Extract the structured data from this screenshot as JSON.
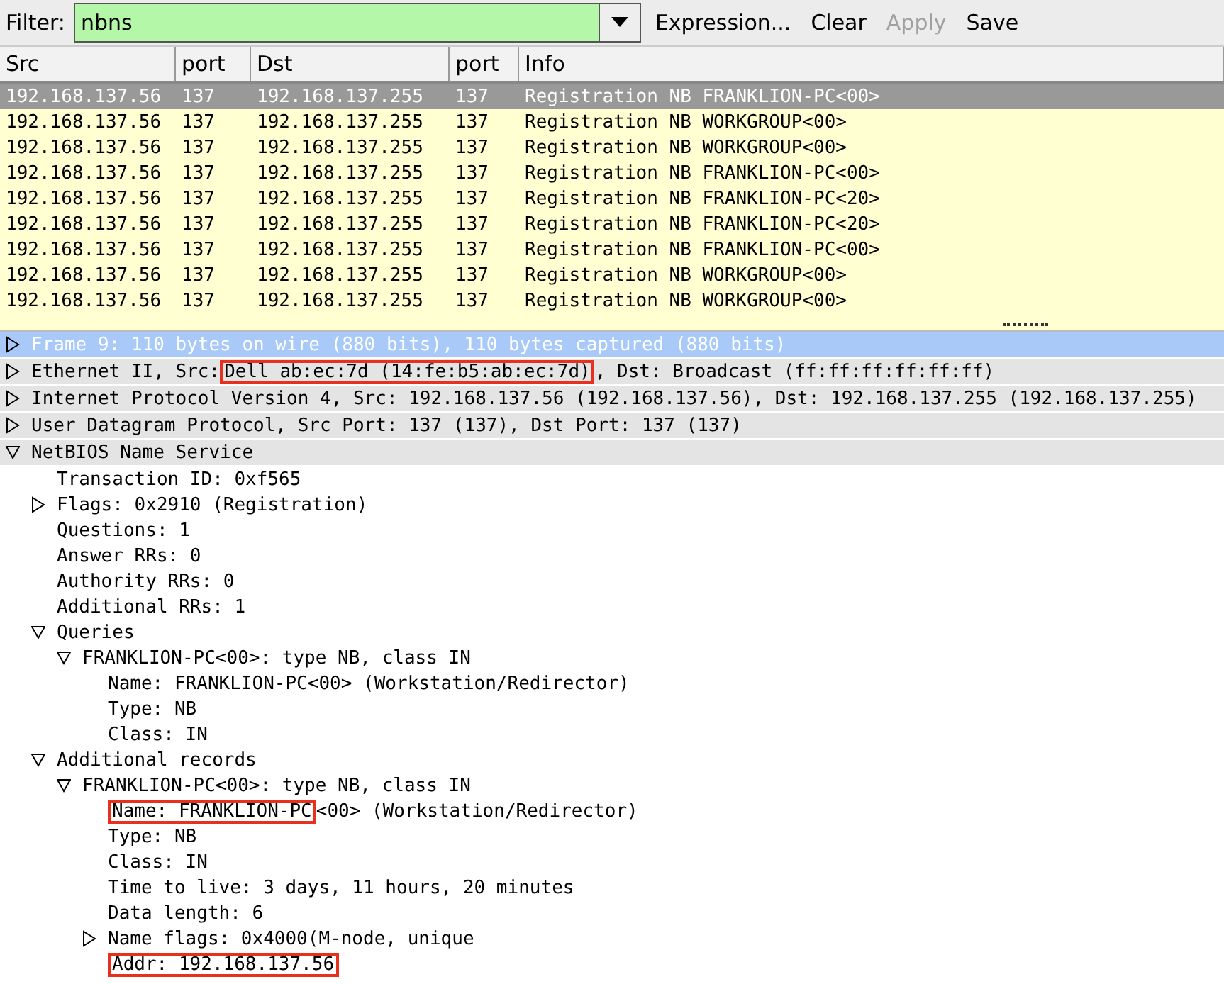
{
  "filter": {
    "label": "Filter:",
    "value": "nbns",
    "buttons": [
      {
        "label": "Expression...",
        "disabled": false
      },
      {
        "label": "Clear",
        "disabled": false
      },
      {
        "label": "Apply",
        "disabled": true
      },
      {
        "label": "Save",
        "disabled": false
      }
    ]
  },
  "packets": {
    "columns": [
      "Src",
      "port",
      "Dst",
      "port",
      "Info"
    ],
    "rows": [
      {
        "cells": [
          "192.168.137.56",
          "137",
          "192.168.137.255",
          "137",
          "Registration NB FRANKLION-PC<00>"
        ],
        "selected": true
      },
      {
        "cells": [
          "192.168.137.56",
          "137",
          "192.168.137.255",
          "137",
          "Registration NB WORKGROUP<00>"
        ],
        "selected": false
      },
      {
        "cells": [
          "192.168.137.56",
          "137",
          "192.168.137.255",
          "137",
          "Registration NB WORKGROUP<00>"
        ],
        "selected": false
      },
      {
        "cells": [
          "192.168.137.56",
          "137",
          "192.168.137.255",
          "137",
          "Registration NB FRANKLION-PC<00>"
        ],
        "selected": false
      },
      {
        "cells": [
          "192.168.137.56",
          "137",
          "192.168.137.255",
          "137",
          "Registration NB FRANKLION-PC<20>"
        ],
        "selected": false
      },
      {
        "cells": [
          "192.168.137.56",
          "137",
          "192.168.137.255",
          "137",
          "Registration NB FRANKLION-PC<20>"
        ],
        "selected": false
      },
      {
        "cells": [
          "192.168.137.56",
          "137",
          "192.168.137.255",
          "137",
          "Registration NB FRANKLION-PC<00>"
        ],
        "selected": false
      },
      {
        "cells": [
          "192.168.137.56",
          "137",
          "192.168.137.255",
          "137",
          "Registration NB WORKGROUP<00>"
        ],
        "selected": false
      },
      {
        "cells": [
          "192.168.137.56",
          "137",
          "192.168.137.255",
          "137",
          "Registration NB WORKGROUP<00>"
        ],
        "selected": false
      }
    ]
  },
  "details": [
    {
      "text": "Frame 9: 110 bytes on wire (880 bits), 110 bytes captured (880 bits)",
      "expanded": false,
      "selected": true
    },
    {
      "parts": [
        {
          "text": "Ethernet II, Src: ",
          "boxed": false
        },
        {
          "text": "Dell_ab:ec:7d (14:fe:b5:ab:ec:7d)",
          "boxed": true
        },
        {
          "text": ", Dst: Broadcast (ff:ff:ff:ff:ff:ff)",
          "boxed": false
        }
      ],
      "expanded": false,
      "selected": false
    },
    {
      "text": "Internet Protocol Version 4, Src: 192.168.137.56 (192.168.137.56), Dst: 192.168.137.255 (192.168.137.255)",
      "expanded": false,
      "selected": false
    },
    {
      "text": "User Datagram Protocol, Src Port: 137 (137), Dst Port: 137 (137)",
      "expanded": false,
      "selected": false
    },
    {
      "text": "NetBIOS Name Service",
      "expanded": true,
      "selected": false,
      "children": [
        {
          "text": "Transaction ID: 0xf565"
        },
        {
          "text": "Flags: 0x2910 (Registration)",
          "expanded": false
        },
        {
          "text": "Questions: 1"
        },
        {
          "text": "Answer RRs: 0"
        },
        {
          "text": "Authority RRs: 0"
        },
        {
          "text": "Additional RRs: 1"
        },
        {
          "text": "Queries",
          "expanded": true,
          "children": [
            {
              "text": "FRANKLION-PC<00>: type NB, class IN",
              "expanded": true,
              "children": [
                {
                  "text": "Name: FRANKLION-PC<00> (Workstation/Redirector)"
                },
                {
                  "text": "Type: NB"
                },
                {
                  "text": "Class: IN"
                }
              ]
            }
          ]
        },
        {
          "text": "Additional records",
          "expanded": true,
          "children": [
            {
              "text": "FRANKLION-PC<00>: type NB, class IN",
              "expanded": true,
              "children": [
                {
                  "parts": [
                    {
                      "text": "Name: FRANKLION-PC",
                      "boxed": true
                    },
                    {
                      "text": "<00> (Workstation/Redirector)",
                      "boxed": false
                    }
                  ]
                },
                {
                  "text": "Type: NB"
                },
                {
                  "text": "Class: IN"
                },
                {
                  "text": "Time to live: 3 days, 11 hours, 20 minutes"
                },
                {
                  "text": "Data length: 6"
                },
                {
                  "text": "Name flags: 0x4000(M-node, unique",
                  "expanded": false
                },
                {
                  "parts": [
                    {
                      "text": "Addr: 192.168.137.56",
                      "boxed": true
                    }
                  ]
                }
              ]
            }
          ]
        }
      ]
    }
  ]
}
